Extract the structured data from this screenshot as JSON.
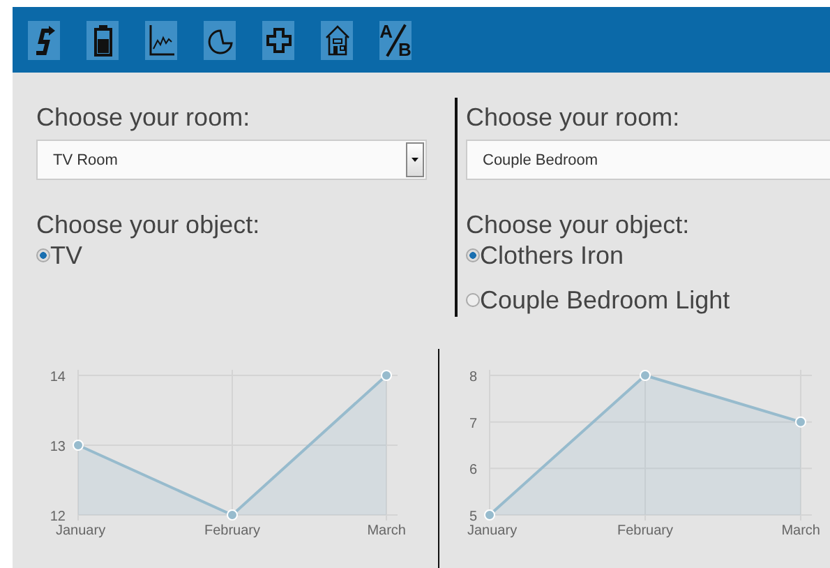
{
  "toolbar": [
    {
      "kind": "route"
    },
    {
      "kind": "battery"
    },
    {
      "kind": "graph"
    },
    {
      "kind": "pie"
    },
    {
      "kind": "plus"
    },
    {
      "kind": "house"
    },
    {
      "kind": "ab",
      "glyphs": [
        "A",
        "B"
      ]
    }
  ],
  "panels": [
    {
      "room_label": "Choose your room:",
      "room": "TV Room",
      "object_label": "Choose your object:",
      "objects": [
        {
          "label": "TV",
          "selected": true
        }
      ]
    },
    {
      "room_label": "Choose your room:",
      "room": "Couple Bedroom",
      "object_label": "Choose your object:",
      "objects": [
        {
          "label": "Clothers Iron",
          "selected": true
        },
        {
          "label": "Couple Bedroom Light",
          "selected": false
        }
      ]
    }
  ],
  "charts": [
    {
      "chart_data": {
        "type": "area",
        "categories": [
          "January",
          "February",
          "March"
        ],
        "series": [
          {
            "color": "#97bbcd",
            "values": [
              13,
              12,
              14
            ]
          }
        ],
        "grid": true,
        "ylim": [
          12,
          14
        ],
        "yticks": [
          12,
          13,
          14
        ]
      }
    },
    {
      "chart_data": {
        "type": "area",
        "categories": [
          "January",
          "February",
          "March"
        ],
        "series": [
          {
            "color": "#97bbcd",
            "values": [
              5,
              8,
              7
            ]
          }
        ],
        "grid": true,
        "ylim": [
          5,
          8
        ],
        "yticks": [
          5,
          6,
          7,
          8
        ]
      }
    }
  ]
}
